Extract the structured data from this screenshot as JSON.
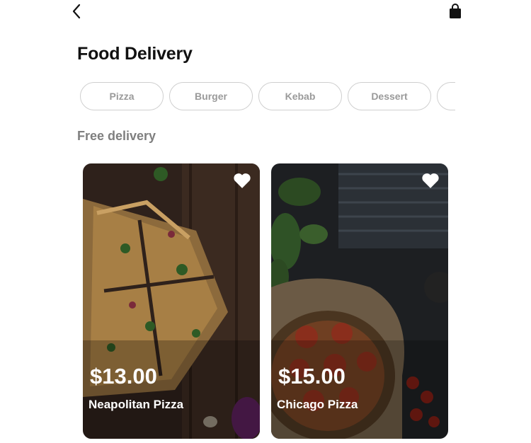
{
  "header": {
    "back_icon": "chevron-left-icon",
    "bag_icon": "shopping-bag-icon"
  },
  "page": {
    "title": "Food Delivery"
  },
  "categories": [
    {
      "label": "Pizza"
    },
    {
      "label": "Burger"
    },
    {
      "label": "Kebab"
    },
    {
      "label": "Dessert"
    },
    {
      "label": ""
    }
  ],
  "section": {
    "title": "Free delivery"
  },
  "products": [
    {
      "price": "$13.00",
      "name": "Neapolitan Pizza",
      "favorite_icon": "heart-icon"
    },
    {
      "price": "$15.00",
      "name": "Chicago Pizza",
      "favorite_icon": "heart-icon"
    }
  ],
  "colors": {
    "text_primary": "#111111",
    "text_muted": "#7f7f7f",
    "chip_border": "#cfcfcf",
    "chip_text": "#9a9a9a"
  }
}
